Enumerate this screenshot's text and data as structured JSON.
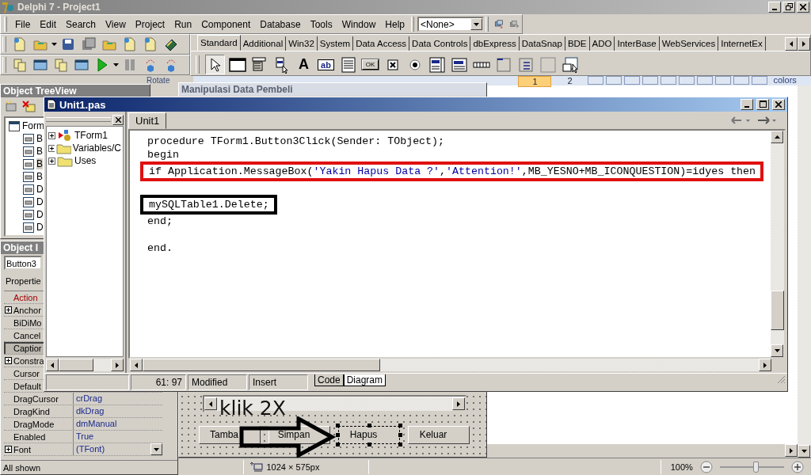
{
  "ide": {
    "title": "Delphi 7 - Project1",
    "menu": [
      "File",
      "Edit",
      "Search",
      "View",
      "Project",
      "Run",
      "Component",
      "Database",
      "Tools",
      "Window",
      "Help"
    ],
    "config_combo": "<None>",
    "palette_tabs": [
      {
        "label": "Standard",
        "selected": true
      },
      {
        "label": "Additional",
        "selected": false
      },
      {
        "label": "Win32",
        "selected": false
      },
      {
        "label": "System",
        "selected": false
      },
      {
        "label": "Data Access",
        "selected": false
      },
      {
        "label": "Data Controls",
        "selected": false
      },
      {
        "label": "dbExpress",
        "selected": false
      },
      {
        "label": "DataSnap",
        "selected": false
      },
      {
        "label": "BDE",
        "selected": false
      },
      {
        "label": "ADO",
        "selected": false
      },
      {
        "label": "InterBase",
        "selected": false
      },
      {
        "label": "WebServices",
        "selected": false
      },
      {
        "label": "InternetEx",
        "selected": false
      }
    ],
    "palette": [
      {
        "kind": "pointer",
        "selected": true
      },
      {
        "kind": "frame",
        "selected": false
      },
      {
        "kind": "mainmenu",
        "selected": false
      },
      {
        "kind": "popupmenu",
        "selected": false
      },
      {
        "kind": "label",
        "glyph": "A",
        "selected": false
      },
      {
        "kind": "edit",
        "glyph": "ab",
        "selected": false
      },
      {
        "kind": "memo",
        "selected": false
      },
      {
        "kind": "button",
        "glyph": "OK",
        "selected": false
      },
      {
        "kind": "checkbox",
        "selected": false
      },
      {
        "kind": "radio",
        "selected": false
      },
      {
        "kind": "listbox",
        "selected": false
      },
      {
        "kind": "combobox",
        "selected": false
      },
      {
        "kind": "scrollbar",
        "selected": false
      },
      {
        "kind": "groupbox",
        "selected": false
      },
      {
        "kind": "radiogroup",
        "selected": false
      },
      {
        "kind": "panel",
        "selected": false
      },
      {
        "kind": "actionlist",
        "selected": false
      }
    ]
  },
  "backdrop": {
    "rotate_label": "Rotate",
    "page_tabs": [
      {
        "label": "1",
        "selected": true
      },
      {
        "label": "2",
        "selected": false
      }
    ],
    "colors_label": "colors",
    "form_title": "Manipulasi Data Pembeli"
  },
  "object_treeview": {
    "title": "Object TreeView",
    "items": [
      {
        "label": "Form",
        "children": [
          {
            "label": "B",
            "selected": false
          },
          {
            "label": "B",
            "selected": false
          },
          {
            "label": "B",
            "selected": true
          },
          {
            "label": "B",
            "selected": false
          },
          {
            "label": "D",
            "selected": false
          },
          {
            "label": "D",
            "selected": false
          },
          {
            "label": "D",
            "selected": false
          },
          {
            "label": "D",
            "selected": false
          }
        ]
      }
    ]
  },
  "object_inspector": {
    "title": "Object I",
    "object": "Button3",
    "tab": "Propertie",
    "properties": [
      {
        "name": "Action",
        "kind": "reference",
        "selected": false
      },
      {
        "name": "Anchor",
        "kind": "expandable",
        "selected": false
      },
      {
        "name": "BiDiMo",
        "kind": "plain",
        "selected": false
      },
      {
        "name": "Cancel",
        "kind": "plain",
        "selected": false
      },
      {
        "name": "Captior",
        "kind": "plain",
        "selected": true
      },
      {
        "name": "Constra",
        "kind": "expandable",
        "selected": false
      },
      {
        "name": "Cursor",
        "kind": "plain",
        "selected": false
      },
      {
        "name": "Default",
        "kind": "plain",
        "selected": false
      },
      {
        "name": "DragCursor",
        "value": "crDrag",
        "kind": "plain",
        "selected": false
      },
      {
        "name": "DragKind",
        "value": "dkDrag",
        "kind": "plain",
        "selected": false
      },
      {
        "name": "DragMode",
        "value": "dmManual",
        "kind": "plain",
        "selected": false
      },
      {
        "name": "Enabled",
        "value": "True",
        "kind": "plain",
        "selected": false
      },
      {
        "name": "Font",
        "value": "(TFont)",
        "kind": "expandable",
        "selected": false
      }
    ],
    "status": "All shown"
  },
  "editor": {
    "title": "Unit1.pas",
    "explorer": [
      {
        "label": "TForm1",
        "kind": "class"
      },
      {
        "label": "Variables/C",
        "kind": "folder"
      },
      {
        "label": "Uses",
        "kind": "folder"
      }
    ],
    "tabs": [
      {
        "label": "Unit1",
        "selected": true
      }
    ],
    "lines": [
      {
        "tokens": [
          {
            "text": "procedure TForm1.Button3Click(Sender: TObject);",
            "kind": "plain"
          }
        ],
        "kind": "code"
      },
      {
        "tokens": [
          {
            "text": "begin",
            "kind": "plain"
          }
        ],
        "kind": "code"
      },
      {
        "tokens": [
          {
            "text": "if Application.MessageBox(",
            "kind": "plain"
          },
          {
            "text": "'Yakin Hapus Data ?'",
            "kind": "string"
          },
          {
            "text": ",",
            "kind": "plain"
          },
          {
            "text": "'Attention!'",
            "kind": "string"
          },
          {
            "text": ",MB_YESNO+MB_ICONQUESTION)=idyes then",
            "kind": "plain"
          }
        ],
        "kind": "code",
        "color": "#e01010"
      },
      {
        "kind": "blank"
      },
      {
        "tokens": [
          {
            "text": "mySQLTable1.Delete;",
            "kind": "plain"
          }
        ],
        "kind": "code",
        "color": "#000000"
      },
      {
        "tokens": [
          {
            "text": "end;",
            "kind": "plain"
          }
        ],
        "kind": "code"
      },
      {
        "kind": "blank"
      },
      {
        "tokens": [
          {
            "text": "end.",
            "kind": "plain"
          }
        ],
        "kind": "code"
      }
    ],
    "status": {
      "position": "61: 97",
      "modified": "Modified",
      "mode": "Insert"
    },
    "view_tabs": [
      {
        "label": "Code",
        "selected": true
      },
      {
        "label": "Diagram",
        "selected": false
      }
    ]
  },
  "form_designer": {
    "buttons": [
      {
        "label": "Tamba",
        "selected": false
      },
      {
        "label": "Simpan",
        "selected": false
      },
      {
        "label": "Hapus",
        "selected": true
      },
      {
        "label": "Keluar",
        "selected": false
      }
    ]
  },
  "annotations": {
    "caption": "klik 2X"
  },
  "viewer": {
    "size": "1024 × 575px",
    "zoom": "100%",
    "level": 0.55
  }
}
